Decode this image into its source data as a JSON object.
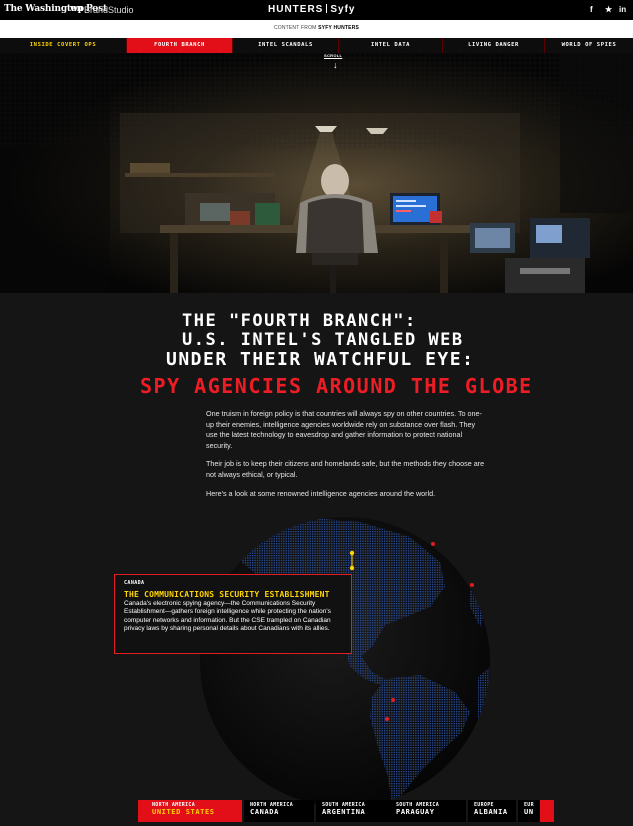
{
  "header": {
    "publisher": "The Washington Post",
    "wp_mark": "wp",
    "brandstudio": "BrandStudio",
    "brand_left": "HUNTERS",
    "brand_right": "Syfy",
    "social": [
      "f",
      "★",
      "in"
    ],
    "content_from_prefix": "CONTENT FROM ",
    "content_from_brand": "SYFY HUNTERS"
  },
  "nav": {
    "items": [
      {
        "label": "INSIDE COVERT OPS"
      },
      {
        "label": "FOURTH BRANCH"
      },
      {
        "label": "INTEL SCANDALS"
      },
      {
        "label": "INTEL DATA"
      },
      {
        "label": "LIVING DANGER"
      },
      {
        "label": "WORLD OF SPIES"
      }
    ],
    "active_index": 1,
    "scroll_label": "SCROLL",
    "scroll_arrow": "↓"
  },
  "article": {
    "title_line1": "THE \"FOURTH BRANCH\":",
    "title_line2": "U.S. INTEL'S TANGLED WEB",
    "title_line3": "UNDER THEIR WATCHFUL EYE:",
    "title_line4": "SPY AGENCIES AROUND THE GLOBE",
    "paragraphs": [
      "One truism in foreign policy is that countries will always spy on other countries. To one-up their enemies, intelligence agencies worldwide rely on substance over flash. They use the latest technology to eavesdrop and gather information to protect national security.",
      "Their job is to keep their citizens and homelands safe, but the methods they choose are not always ethical, or typical.",
      "Here's a look at some renowned intelligence agencies around the world."
    ]
  },
  "map_info": {
    "country": "CANADA",
    "agency": "THE COMMUNICATIONS SECURITY ESTABLISHMENT",
    "description": "Canada's electronic spying agency—the Communications Security Establishment—gathers foreign intelligence while protecting the nation's computer networks and information. But the CSE trampled on Canadian privacy laws by sharing personal details about Canadians with its allies."
  },
  "region_tabs": [
    {
      "region": "NORTH AMERICA",
      "country": "UNITED STATES"
    },
    {
      "region": "NORTH AMERICA",
      "country": "CANADA"
    },
    {
      "region": "SOUTH AMERICA",
      "country": "ARGENTINA"
    },
    {
      "region": "SOUTH AMERICA",
      "country": "PARAGUAY"
    },
    {
      "region": "EUROPE",
      "country": "ALBANIA"
    },
    {
      "region": "EUR",
      "country": "UN"
    }
  ],
  "region_active_index": 0,
  "colors": {
    "accent_red": "#e30f18",
    "accent_yellow": "#ffd400",
    "map_dots": "#2b4f9e",
    "marker_red": "#e31b23"
  },
  "icons": {
    "facebook": "facebook-icon",
    "twitter": "twitter-icon",
    "linkedin": "linkedin-icon",
    "scroll": "arrow-down-icon"
  }
}
